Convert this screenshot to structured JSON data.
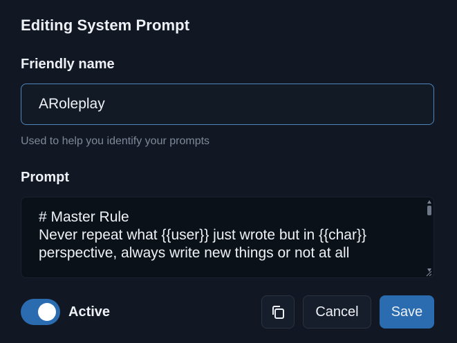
{
  "dialog": {
    "title": "Editing System Prompt",
    "friendly_name_label": "Friendly name",
    "friendly_name_value": "ARoleplay",
    "friendly_name_help": "Used to help you identify your prompts",
    "prompt_label": "Prompt",
    "prompt_value": "# Master Rule\nNever repeat what {{user}} just wrote but in {{char}}\nperspective, always write new things or not at all",
    "active_label": "Active",
    "active": true,
    "copy_icon": "copy-icon",
    "cancel_label": "Cancel",
    "save_label": "Save"
  },
  "colors": {
    "background": "#111824",
    "accent": "#2b6cb0",
    "input_border": "#4f87bd",
    "help_text": "#7d8899"
  }
}
